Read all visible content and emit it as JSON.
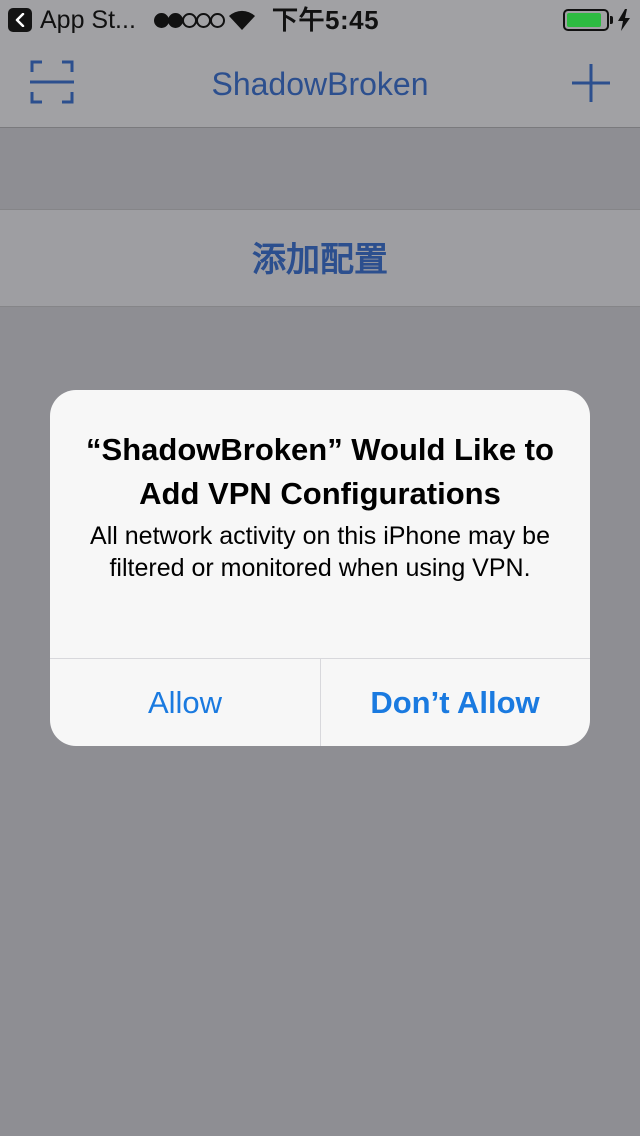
{
  "status_bar": {
    "back_app": "App St...",
    "signal_bars_filled": 2,
    "signal_bars_total": 5,
    "time": "下午5:45",
    "battery_level": 0.9,
    "battery_color": "#2dbb41"
  },
  "nav": {
    "title": "ShadowBroken",
    "left_icon": "scan-icon",
    "right_icon": "plus-icon"
  },
  "content": {
    "add_config_label": "添加配置"
  },
  "alert": {
    "title": "“ShadowBroken” Would Like to Add VPN Configurations",
    "message": "All network activity on this iPhone may be filtered or monitored when using VPN.",
    "allow_label": "Allow",
    "dont_allow_label": "Don’t Allow"
  },
  "colors": {
    "accent": "#1a7ae0",
    "nav_tint": "#2c4f8e",
    "dim_background": "#8e8e93"
  }
}
